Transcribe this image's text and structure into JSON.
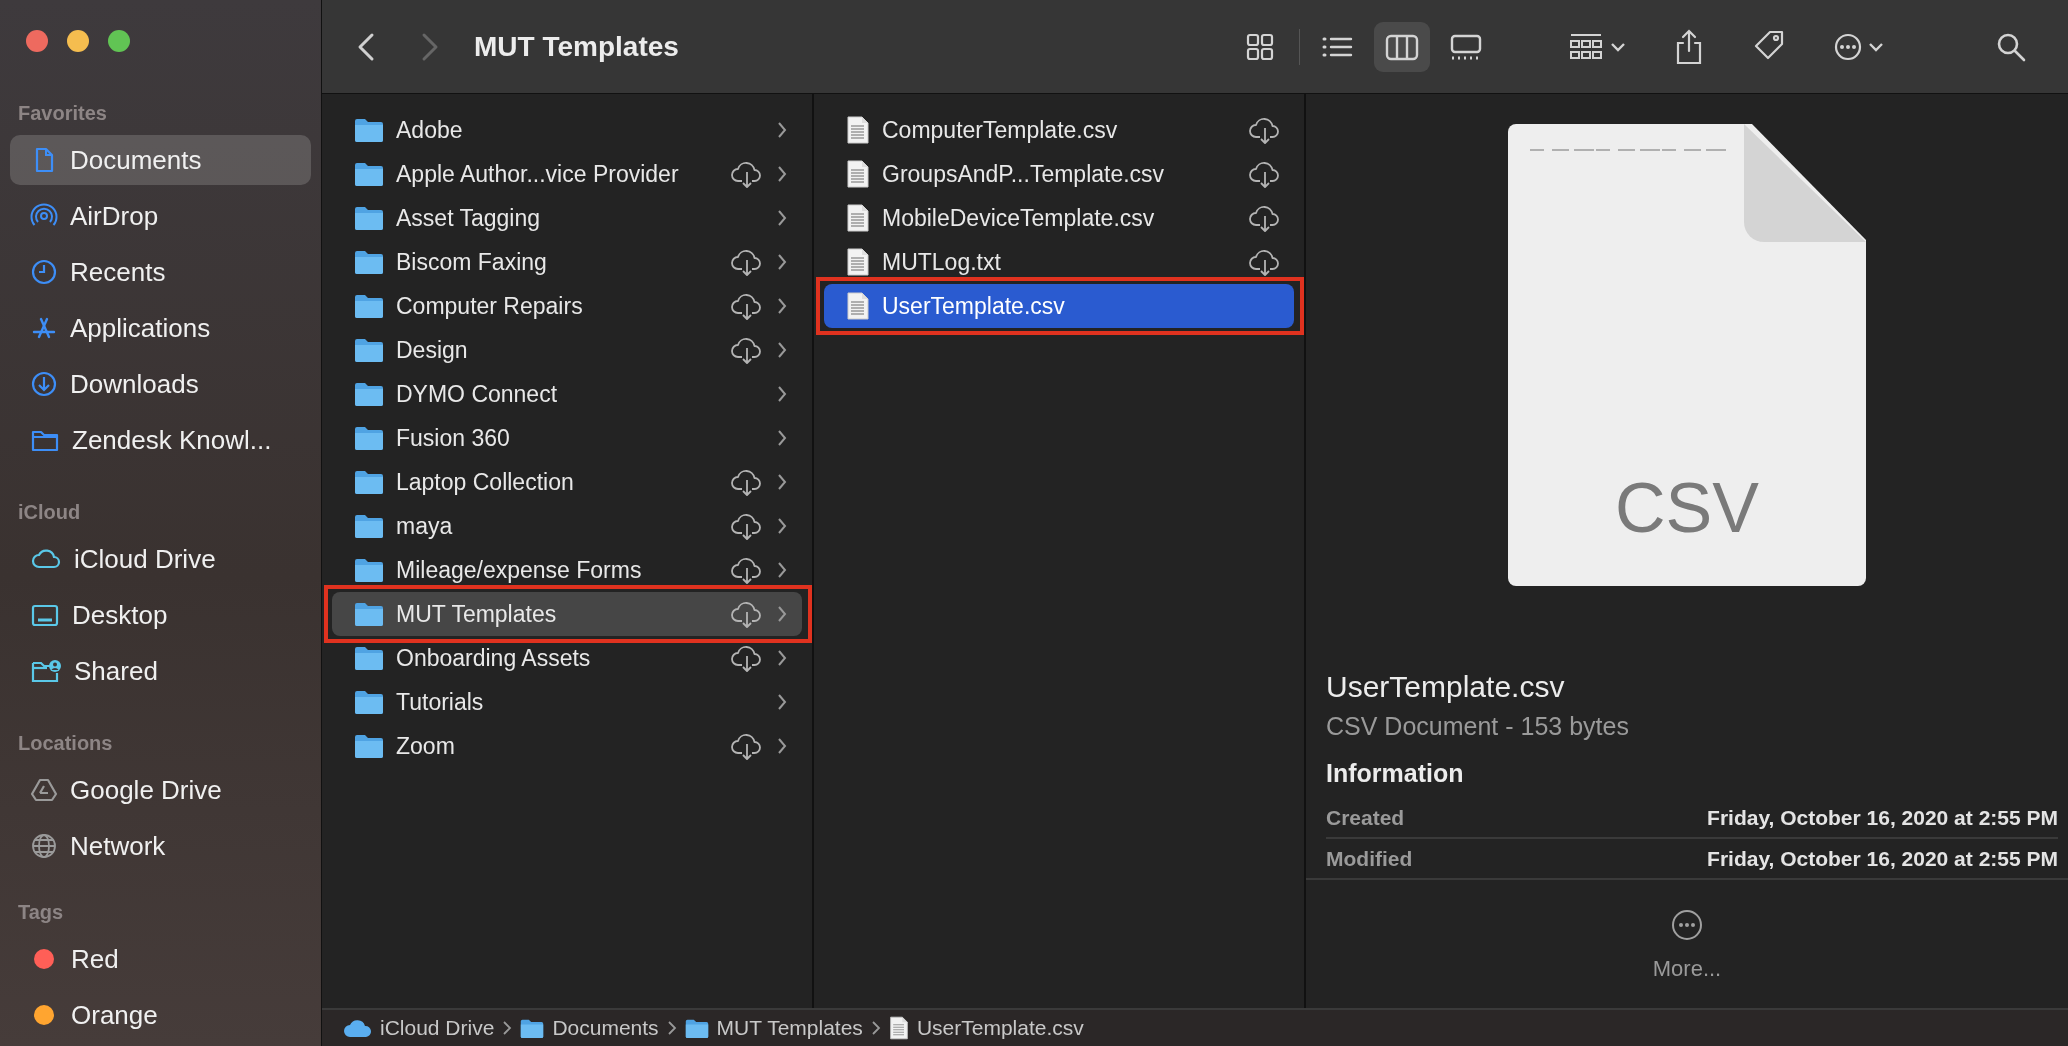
{
  "toolbar": {
    "back_enabled": true,
    "forward_enabled": false,
    "title": "MUT Templates",
    "view_modes": [
      {
        "selected": false
      },
      {
        "selected": false
      },
      {
        "selected": true
      },
      {
        "selected": false
      }
    ]
  },
  "sidebar": {
    "sections": [
      {
        "title": "Favorites",
        "items": [
          {
            "label": "Documents",
            "selected": true
          },
          {
            "label": "AirDrop",
            "selected": false
          },
          {
            "label": "Recents",
            "selected": false
          },
          {
            "label": "Applications",
            "selected": false
          },
          {
            "label": "Downloads",
            "selected": false
          },
          {
            "label": "Zendesk Knowl...",
            "selected": false
          }
        ]
      },
      {
        "title": "iCloud",
        "items": [
          {
            "label": "iCloud Drive",
            "selected": false
          },
          {
            "label": "Desktop",
            "selected": false
          },
          {
            "label": "Shared",
            "selected": false
          }
        ]
      },
      {
        "title": "Locations",
        "items": [
          {
            "label": "Google Drive",
            "selected": false
          },
          {
            "label": "Network",
            "selected": false
          }
        ]
      },
      {
        "title": "Tags",
        "items": [
          {
            "label": "Red",
            "selected": false,
            "color": "#ff5f57"
          },
          {
            "label": "Orange",
            "selected": false,
            "color": "#ffa530"
          }
        ]
      }
    ]
  },
  "columns": [
    {
      "focused": false,
      "items": [
        {
          "kind": "folder",
          "name": "Adobe",
          "cloud": false,
          "selected": false,
          "annotated": false
        },
        {
          "kind": "folder",
          "name": "Apple Author...vice Provider",
          "cloud": true,
          "selected": false,
          "annotated": false
        },
        {
          "kind": "folder",
          "name": "Asset Tagging",
          "cloud": false,
          "selected": false,
          "annotated": false
        },
        {
          "kind": "folder",
          "name": "Biscom Faxing",
          "cloud": true,
          "selected": false,
          "annotated": false
        },
        {
          "kind": "folder",
          "name": "Computer Repairs",
          "cloud": true,
          "selected": false,
          "annotated": false
        },
        {
          "kind": "folder",
          "name": "Design",
          "cloud": true,
          "selected": false,
          "annotated": false
        },
        {
          "kind": "folder",
          "name": "DYMO Connect",
          "cloud": false,
          "selected": false,
          "annotated": false
        },
        {
          "kind": "folder",
          "name": "Fusion 360",
          "cloud": false,
          "selected": false,
          "annotated": false
        },
        {
          "kind": "folder",
          "name": "Laptop Collection",
          "cloud": true,
          "selected": false,
          "annotated": false
        },
        {
          "kind": "folder",
          "name": "maya",
          "cloud": true,
          "selected": false,
          "annotated": false
        },
        {
          "kind": "folder",
          "name": "Mileage/expense Forms",
          "cloud": true,
          "selected": false,
          "annotated": false
        },
        {
          "kind": "folder",
          "name": "MUT Templates",
          "cloud": true,
          "selected": true,
          "annotated": true
        },
        {
          "kind": "folder",
          "name": "Onboarding Assets",
          "cloud": true,
          "selected": false,
          "annotated": false
        },
        {
          "kind": "folder",
          "name": "Tutorials",
          "cloud": false,
          "selected": false,
          "annotated": false
        },
        {
          "kind": "folder",
          "name": "Zoom",
          "cloud": true,
          "selected": false,
          "annotated": false
        }
      ]
    },
    {
      "focused": true,
      "items": [
        {
          "kind": "file",
          "name": "ComputerTemplate.csv",
          "cloud": true,
          "selected": false,
          "annotated": false
        },
        {
          "kind": "file",
          "name": "GroupsAndP...Template.csv",
          "cloud": true,
          "selected": false,
          "annotated": false
        },
        {
          "kind": "file",
          "name": "MobileDeviceTemplate.csv",
          "cloud": true,
          "selected": false,
          "annotated": false
        },
        {
          "kind": "file",
          "name": "MUTLog.txt",
          "cloud": true,
          "selected": false,
          "annotated": false
        },
        {
          "kind": "file",
          "name": "UserTemplate.csv",
          "cloud": false,
          "selected": true,
          "annotated": true
        }
      ]
    }
  ],
  "preview": {
    "thumbnail_label": "CSV",
    "name": "UserTemplate.csv",
    "description": "CSV Document - 153 bytes",
    "section_title": "Information",
    "info": [
      {
        "label": "Created",
        "value": "Friday, October 16, 2020 at 2:55 PM"
      },
      {
        "label": "Modified",
        "value": "Friday, October 16, 2020 at 2:55 PM"
      }
    ],
    "more_label": "More..."
  },
  "path_bar": [
    {
      "kind": "cloud",
      "label": "iCloud Drive"
    },
    {
      "kind": "folder",
      "label": "Documents"
    },
    {
      "kind": "folder",
      "label": "MUT Templates"
    },
    {
      "kind": "file",
      "label": "UserTemplate.csv"
    }
  ]
}
